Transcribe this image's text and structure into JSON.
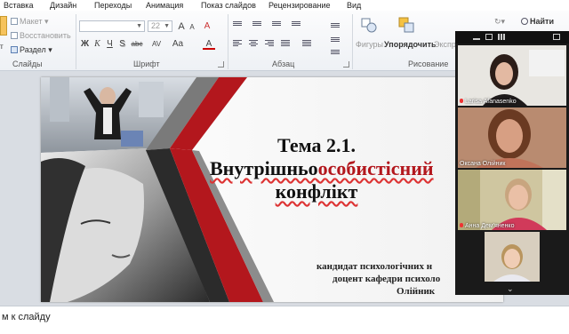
{
  "menubar": {
    "items": [
      "Вставка",
      "Дизайн",
      "Переходы",
      "Анимация",
      "Показ слайдов",
      "Рецензирование",
      "Вид"
    ]
  },
  "ribbon": {
    "slides": {
      "layout": "Макет",
      "reset": "Восстановить",
      "section": "Раздел",
      "group": "Слайды"
    },
    "font": {
      "size": "22",
      "group": "Шрифт",
      "bold": "Ж",
      "italic": "К",
      "underline": "Ч",
      "shadow": "S",
      "strike": "abc",
      "spacing": "AV",
      "case": "Aa",
      "color": "A",
      "grow": "A",
      "shrink": "A",
      "clear": "A"
    },
    "paragraph": {
      "group": "Абзац"
    },
    "drawing": {
      "shapes": "Фигуры",
      "arrange": "Упорядочить",
      "express": "Экспр",
      "group": "Рисование"
    },
    "find": "Найти"
  },
  "slide": {
    "title_line1": "Тема 2.1.",
    "title_line2_a": "Внутрішньо",
    "title_line2_b": "особистісний",
    "title_line3": "конфлікт",
    "author_line1": "кандидат психологічних н",
    "author_line2": "доцент кафедри психоло",
    "author_line3": "Олійник"
  },
  "notes": {
    "placeholder": "м к слайду"
  },
  "video": {
    "participants": [
      {
        "name": "Larisa Afanasenko"
      },
      {
        "name": "Оксана Олійник"
      },
      {
        "name": "Анна Дем'яненко"
      },
      {
        "name": ""
      }
    ]
  },
  "colors": {
    "accent_red": "#b3171d",
    "ribbon_bg": "#eef1f5",
    "workspace_bg": "#d9dde3"
  }
}
